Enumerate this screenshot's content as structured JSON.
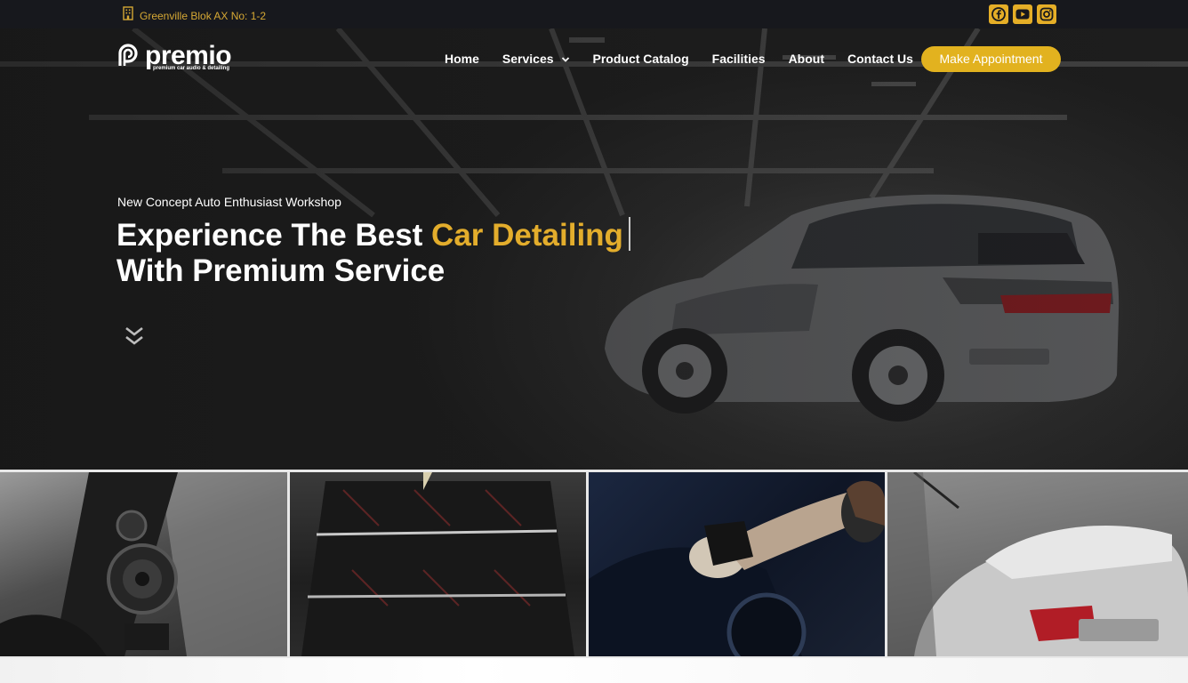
{
  "topbar": {
    "address": "Greenville Blok AX No: 1-2",
    "address_icon": "building-icon",
    "social": [
      {
        "icon": "facebook-icon",
        "label": "Facebook"
      },
      {
        "icon": "youtube-icon",
        "label": "YouTube"
      },
      {
        "icon": "instagram-icon",
        "label": "Instagram"
      }
    ]
  },
  "brand": {
    "name": "premio",
    "tagline": "premium car audio & detailing"
  },
  "nav": {
    "items": [
      "Home",
      "Services",
      "Product Catalog",
      "Facilities",
      "About",
      "Contact Us"
    ],
    "cta": "Make Appointment"
  },
  "hero": {
    "eyebrow": "New Concept Auto Enthusiast Workshop",
    "headline_part1": "Experience The Best ",
    "headline_accent": "Car Detailing",
    "headline_part2": "With Premium Service",
    "scroll_icon": "chevron-double-down-icon"
  },
  "colors": {
    "accent": "#e2b21f",
    "topbar_bg": "#17181d",
    "address_text": "#d6a834"
  }
}
